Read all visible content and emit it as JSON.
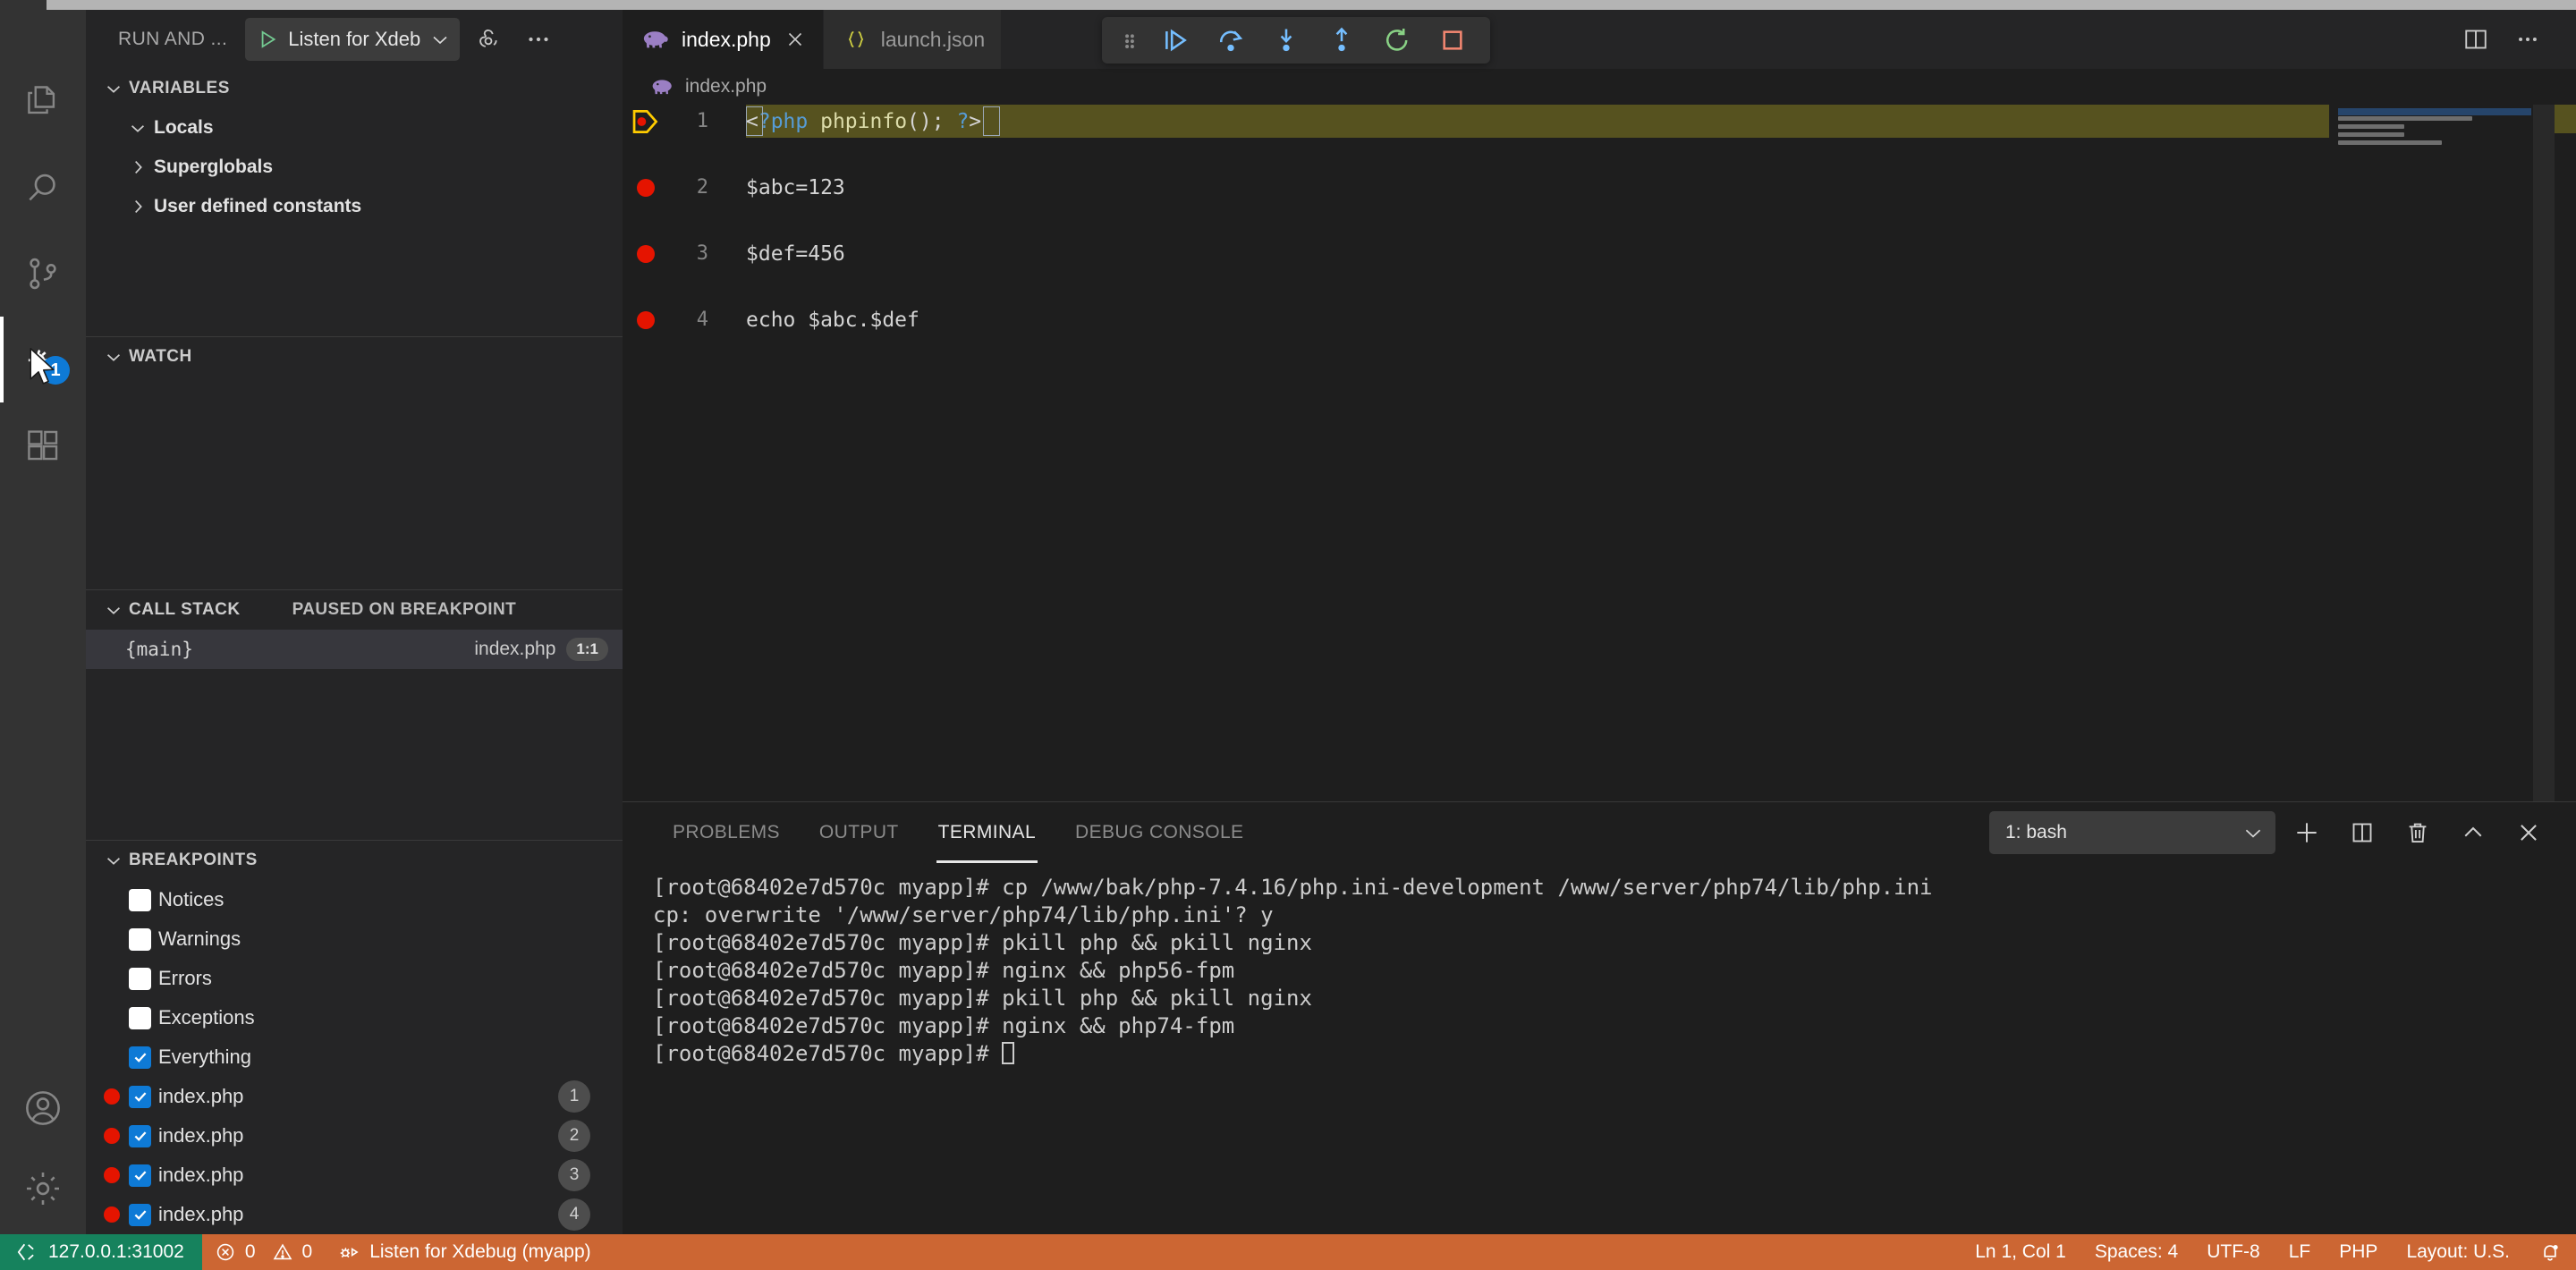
{
  "window": {
    "split_editor_label": "split-editor",
    "more_actions_label": "more-actions"
  },
  "activitybar": {
    "menu_icon": "hamburger-menu-icon",
    "items": [
      {
        "name": "explorer",
        "icon": "files-icon",
        "active": false,
        "badge": ""
      },
      {
        "name": "search",
        "icon": "search-icon",
        "active": false,
        "badge": ""
      },
      {
        "name": "source-control",
        "icon": "source-control-icon",
        "active": false,
        "badge": ""
      },
      {
        "name": "run-and-debug",
        "icon": "debug-icon",
        "active": true,
        "badge": "1"
      },
      {
        "name": "extensions",
        "icon": "extensions-icon",
        "active": false,
        "badge": ""
      }
    ],
    "bottom": [
      {
        "name": "accounts",
        "icon": "account-icon"
      },
      {
        "name": "manage",
        "icon": "gear-icon"
      }
    ]
  },
  "sidebar": {
    "title": "RUN AND ...",
    "launch_config": "Listen for Xdeb",
    "start_debug_icon": "play-icon",
    "config_gear_icon": "gear-icon",
    "more_icon": "ellipsis-icon",
    "variables": {
      "header": "VARIABLES",
      "scopes": [
        {
          "label": "Locals",
          "expanded": true
        },
        {
          "label": "Superglobals",
          "expanded": false
        },
        {
          "label": "User defined constants",
          "expanded": false
        }
      ]
    },
    "watch": {
      "header": "WATCH",
      "items": []
    },
    "callstack": {
      "header": "CALL STACK",
      "status": "PAUSED ON BREAKPOINT",
      "frames": [
        {
          "function": "{main}",
          "file": "index.php",
          "position": "1:1"
        }
      ]
    },
    "breakpoints": {
      "header": "BREAKPOINTS",
      "items": [
        {
          "label": "Notices",
          "checked": false,
          "has_dot": false,
          "line": ""
        },
        {
          "label": "Warnings",
          "checked": false,
          "has_dot": false,
          "line": ""
        },
        {
          "label": "Errors",
          "checked": false,
          "has_dot": false,
          "line": ""
        },
        {
          "label": "Exceptions",
          "checked": false,
          "has_dot": false,
          "line": ""
        },
        {
          "label": "Everything",
          "checked": true,
          "has_dot": false,
          "line": ""
        },
        {
          "label": "index.php",
          "checked": true,
          "has_dot": true,
          "line": "1"
        },
        {
          "label": "index.php",
          "checked": true,
          "has_dot": true,
          "line": "2"
        },
        {
          "label": "index.php",
          "checked": true,
          "has_dot": true,
          "line": "3"
        },
        {
          "label": "index.php",
          "checked": true,
          "has_dot": true,
          "line": "4"
        }
      ]
    }
  },
  "editor": {
    "tabs": [
      {
        "name": "index.php",
        "icon": "php-elephant-icon",
        "active": true,
        "closable": true
      },
      {
        "name": "launch.json",
        "icon": "json-braces-icon",
        "active": false,
        "closable": false
      }
    ],
    "breadcrumb": {
      "icon": "php-elephant-icon",
      "text": "index.php"
    },
    "debug_toolbar": {
      "grip": "drag-handle-icon",
      "buttons": [
        {
          "name": "continue",
          "icon": "continue-icon",
          "color": "#75beff"
        },
        {
          "name": "step-over",
          "icon": "step-over-icon",
          "color": "#75beff"
        },
        {
          "name": "step-into",
          "icon": "step-into-icon",
          "color": "#75beff"
        },
        {
          "name": "step-out",
          "icon": "step-out-icon",
          "color": "#75beff"
        },
        {
          "name": "restart",
          "icon": "restart-icon",
          "color": "#89d185"
        },
        {
          "name": "stop",
          "icon": "stop-icon",
          "color": "#f48771"
        }
      ]
    },
    "lines": [
      {
        "number": "1",
        "text": "<?php phpinfo(); ?>",
        "breakpoint": true,
        "current": true,
        "tokens": [
          {
            "t": "<",
            "c": "tok-punct"
          },
          {
            "t": "?php",
            "c": "tok-php"
          },
          {
            "t": " ",
            "c": "tok-punct"
          },
          {
            "t": "phpinfo",
            "c": "tok-fn"
          },
          {
            "t": "(); ",
            "c": "tok-punct"
          },
          {
            "t": "?",
            "c": "tok-php"
          },
          {
            "t": ">",
            "c": "tok-punct"
          }
        ]
      },
      {
        "number": "2",
        "text": "$abc=123",
        "breakpoint": true,
        "current": false,
        "tokens": [
          {
            "t": "$abc=123",
            "c": "tok-punct"
          }
        ]
      },
      {
        "number": "3",
        "text": "$def=456",
        "breakpoint": true,
        "current": false,
        "tokens": [
          {
            "t": "$def=456",
            "c": "tok-punct"
          }
        ]
      },
      {
        "number": "4",
        "text": "echo $abc.$def",
        "breakpoint": true,
        "current": false,
        "tokens": [
          {
            "t": "echo $abc.$def",
            "c": "tok-punct"
          }
        ]
      }
    ]
  },
  "panel": {
    "tabs": [
      {
        "label": "PROBLEMS",
        "active": false
      },
      {
        "label": "OUTPUT",
        "active": false
      },
      {
        "label": "TERMINAL",
        "active": true
      },
      {
        "label": "DEBUG CONSOLE",
        "active": false
      }
    ],
    "terminal_selector": "1: bash",
    "actions": [
      {
        "name": "new-terminal",
        "icon": "plus-icon"
      },
      {
        "name": "split-terminal",
        "icon": "split-icon"
      },
      {
        "name": "kill-terminal",
        "icon": "trash-icon"
      },
      {
        "name": "maximize-panel",
        "icon": "chevron-up-icon"
      },
      {
        "name": "close-panel",
        "icon": "close-icon"
      }
    ],
    "terminal_lines": [
      "[root@68402e7d570c myapp]# cp /www/bak/php-7.4.16/php.ini-development /www/server/php74/lib/php.ini",
      "cp: overwrite '/www/server/php74/lib/php.ini'? y",
      "[root@68402e7d570c myapp]# pkill php && pkill nginx",
      "[root@68402e7d570c myapp]# nginx && php56-fpm",
      "[root@68402e7d570c myapp]# pkill php && pkill nginx",
      "[root@68402e7d570c myapp]# nginx && php74-fpm"
    ],
    "terminal_prompt": "[root@68402e7d570c myapp]# "
  },
  "statusbar": {
    "remote": "127.0.0.1:31002",
    "remote_icon": "remote-icon",
    "errors": "0",
    "warnings": "0",
    "debug_session": "Listen for Xdebug (myapp)",
    "debug_session_icon": "debug-alt-icon",
    "cursor": "Ln 1, Col 1",
    "indent": "Spaces: 4",
    "encoding": "UTF-8",
    "eol": "LF",
    "language": "PHP",
    "layout": "Layout: U.S.",
    "bell_icon": "bell-dot-icon",
    "bg_color": "#cc6633",
    "remote_bg_color": "#16825d"
  }
}
